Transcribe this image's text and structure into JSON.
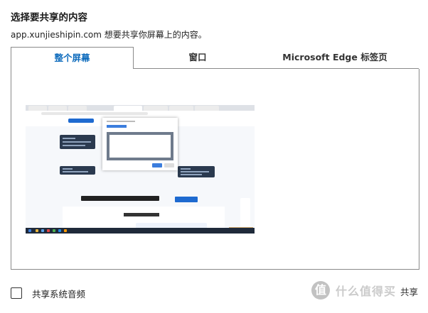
{
  "dialog": {
    "title": "选择要共享的内容",
    "subtitle": "app.xunjieshipin.com 想要共享你屏幕上的内容。"
  },
  "tabs": [
    {
      "label": "整个屏幕",
      "active": true
    },
    {
      "label": "窗口",
      "active": false
    },
    {
      "label": "Microsoft Edge 标签页",
      "active": false
    }
  ],
  "preview": {
    "hero_text": "视频屏幕录制工具 更多功能，尽在迅捷视频",
    "section_title": "在线录制视频工具"
  },
  "footer": {
    "audio_checkbox_label": "共享系统音频",
    "audio_checked": false,
    "share_button": "共享"
  },
  "watermark": {
    "logo": "值",
    "text": "什么值得买"
  },
  "colors": {
    "accent": "#0f6cbd",
    "border": "#8a8a8a"
  }
}
